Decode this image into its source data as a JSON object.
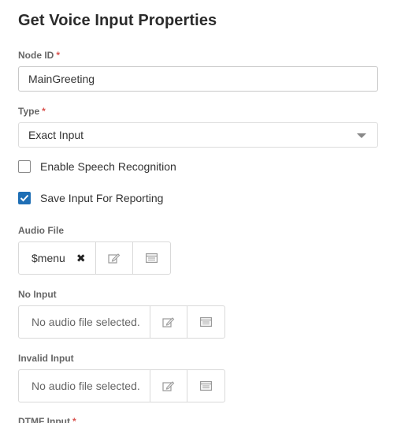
{
  "title": "Get Voice Input Properties",
  "required_marker": "*",
  "node_id": {
    "label": "Node ID",
    "value": "MainGreeting"
  },
  "type": {
    "label": "Type",
    "value": "Exact Input"
  },
  "enable_speech": {
    "label": "Enable Speech Recognition",
    "checked": false
  },
  "save_input": {
    "label": "Save Input For Reporting",
    "checked": true
  },
  "audio_file": {
    "label": "Audio File",
    "value": "$menu",
    "clear_glyph": "✖"
  },
  "no_input": {
    "label": "No Input",
    "value": "No audio file selected."
  },
  "invalid_input": {
    "label": "Invalid Input",
    "value": "No audio file selected."
  },
  "dtmf_input": {
    "label": "DTMF Input"
  },
  "colors": {
    "accent": "#1f6fb5",
    "required": "#d9534f"
  },
  "icons": {
    "edit": "edit-icon",
    "list": "list-icon",
    "dropdown": "chevron-down-icon"
  }
}
